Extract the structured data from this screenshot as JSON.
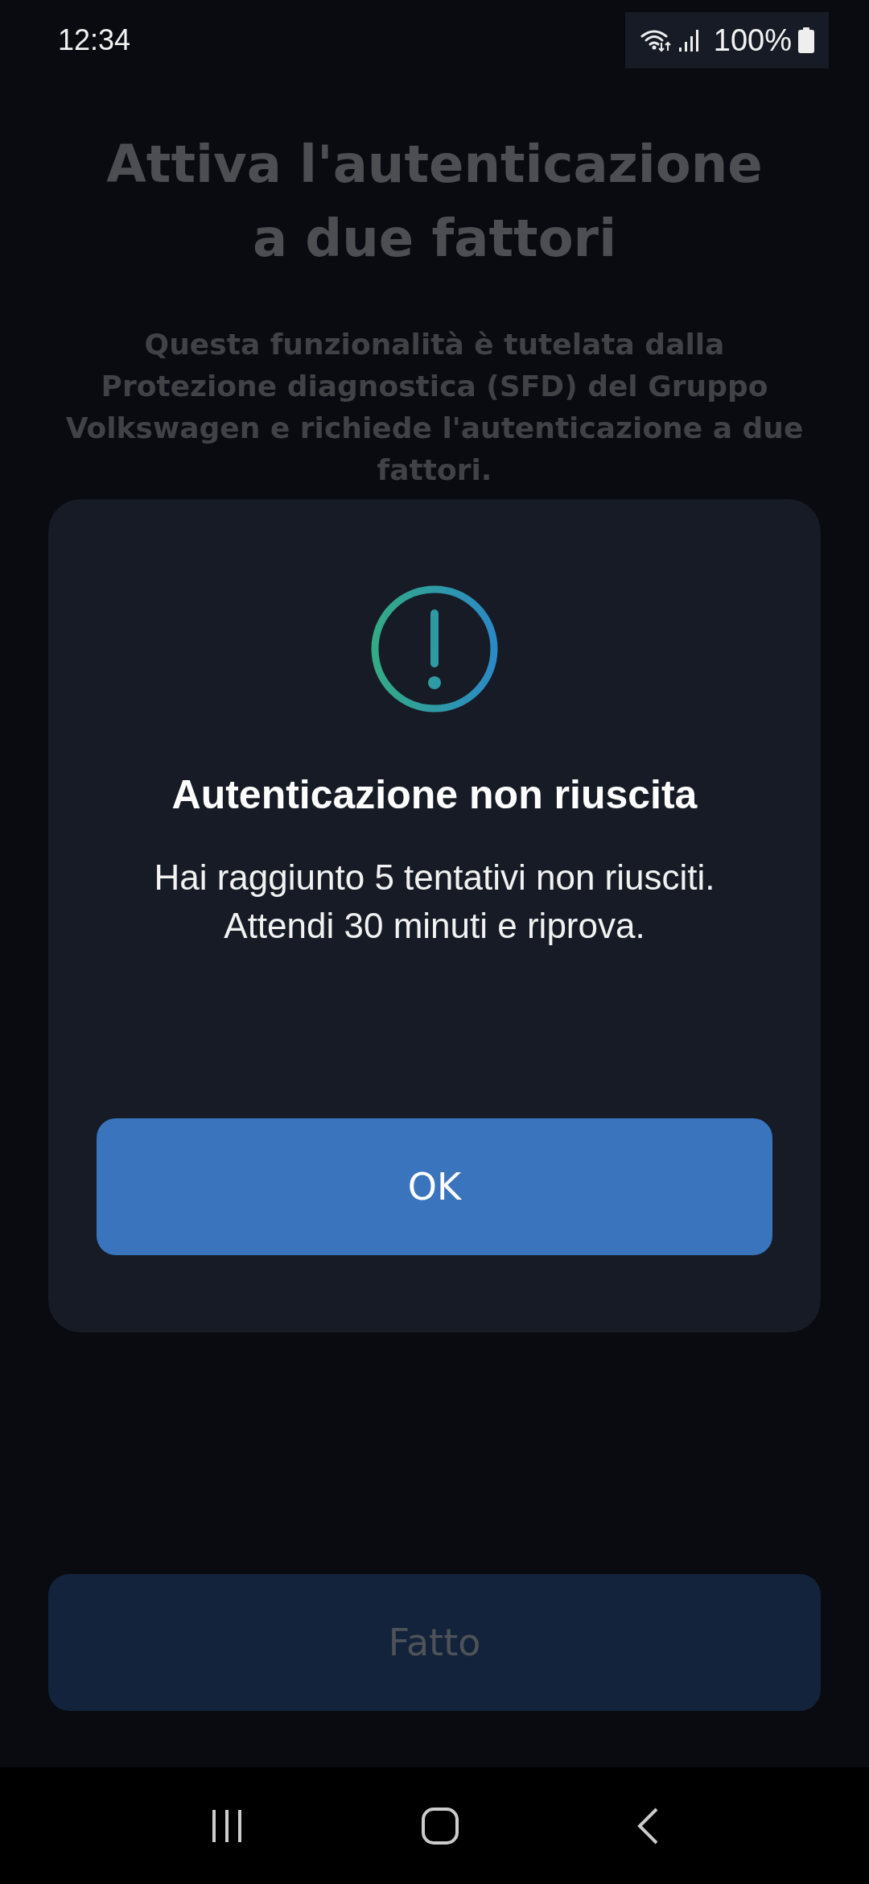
{
  "status_bar": {
    "time": "12:34",
    "battery": "100%"
  },
  "page": {
    "title": "Attiva l'autenticazione a due fattori",
    "description": "Questa funzionalità è tutelata dalla Protezione diagnostica (SFD) del Gruppo Volkswagen e richiede l'autenticazione a due fattori.",
    "done_button": {
      "label": "Fatto",
      "disabled": true
    }
  },
  "dialog": {
    "title": "Autenticazione non riuscita",
    "message": "Hai raggiunto 5 tentativi non riusciti. Attendi 30 minuti e riprova.",
    "button": "OK"
  }
}
